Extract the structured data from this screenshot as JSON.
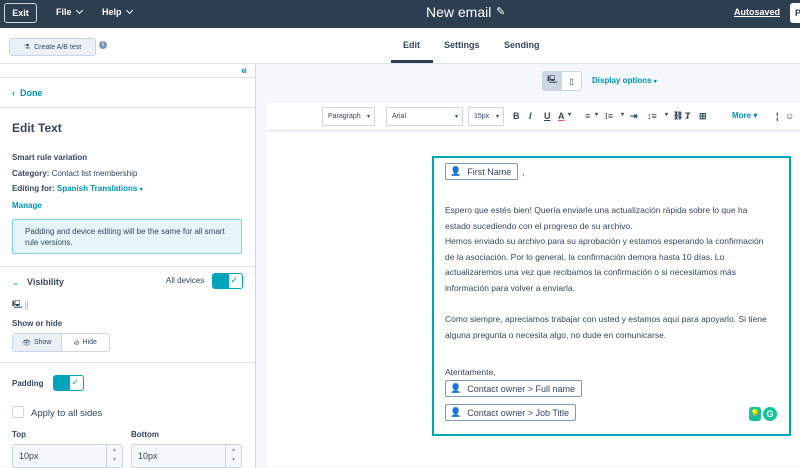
{
  "topbar": {
    "exit_label": "Exit",
    "file_label": "File",
    "help_label": "Help",
    "title": "New email",
    "autosaved_label": "Autosaved",
    "publish_label": "P"
  },
  "subbar": {
    "ab_test_label": "Create A/B test",
    "tabs": [
      {
        "label": "Edit",
        "active": true
      },
      {
        "label": "Settings",
        "active": false
      },
      {
        "label": "Sending",
        "active": false
      }
    ]
  },
  "sidebar": {
    "done_label": "Done",
    "heading": "Edit Text",
    "smart_rule_label": "Smart rule variation",
    "category_label": "Category:",
    "category_value": "Contact list membership",
    "editing_for_label": "Editing for:",
    "editing_for_value": "Spanish Translations",
    "manage_label": "Manage",
    "notice": "Padding and device editing will be the same for all smart rule versions.",
    "visibility_label": "Visibility",
    "all_devices_label": "All devices",
    "show_or_hide_label": "Show or hide",
    "show_label": "Show",
    "hide_label": "Hide",
    "padding_label": "Padding",
    "apply_all_label": "Apply to all sides",
    "top_label": "Top",
    "bottom_label": "Bottom",
    "top_value": "10px",
    "bottom_value": "10px"
  },
  "preview": {
    "display_options_label": "Display options",
    "toolbar": {
      "paragraph": "Paragraph",
      "font": "Arial",
      "size": "15px",
      "more_label": "More"
    },
    "email": {
      "token_first_name": "First Name",
      "after_first_name": ",",
      "paragraph1": "Espero que estés bien! Quería enviarle una actualización rápida sobre lo que ha estado sucediendo con el progreso de su archivo.",
      "paragraph2": "Hemos enviado su archivo para su aprobación y estamos esperando la confirmación de la asociación. Por lo general, la confirmación demora hasta 10 días. Lo actualizaremos una vez que recibamos la confirmación o si necesitamos más información para volver a enviarla.",
      "paragraph3": "Como siempre, apreciamos trabajar con usted y estamos aquí para apoyarlo. Si tiene alguna pregunta o necesita algo, no dude en comunicarse.",
      "signoff": "Atentamente,",
      "token_owner_name": "Contact owner > Full name",
      "token_owner_title": "Contact owner > Job Title",
      "grammarly_label": "G"
    }
  },
  "colors": {
    "header_bg": "#2d3e50",
    "accent": "#00a4bd",
    "link": "#0091ae",
    "text": "#33475b"
  }
}
